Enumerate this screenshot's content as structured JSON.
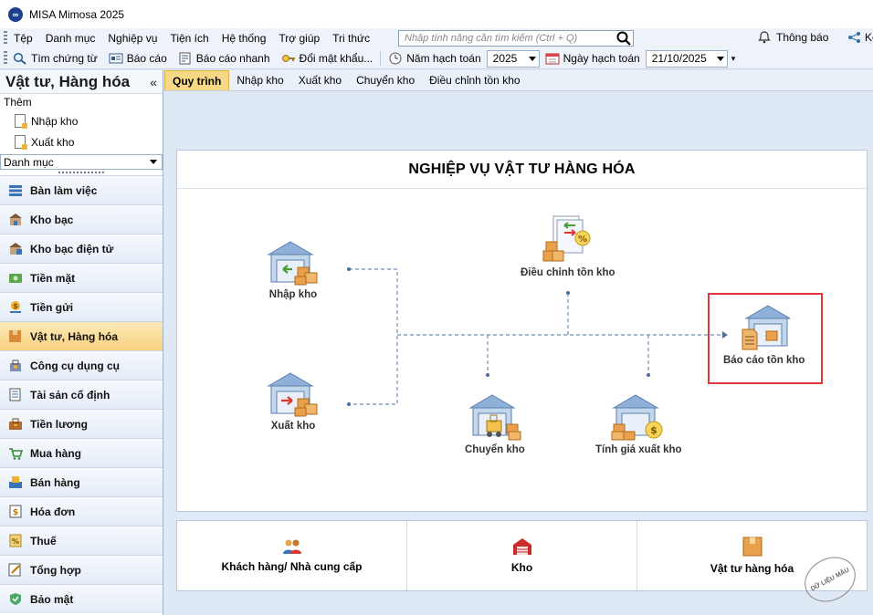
{
  "window": {
    "title": "MISA Mimosa 2025"
  },
  "menu": {
    "items": [
      "Tệp",
      "Danh mục",
      "Nghiệp vụ",
      "Tiện ích",
      "Hệ thống",
      "Trợ giúp",
      "Tri thức"
    ],
    "search_placeholder": "Nhập tính năng cần tìm kiếm (Ctrl + Q)",
    "notification_label": "Thông báo",
    "share_label": "Kế"
  },
  "toolbar": {
    "find_voucher": "Tìm chứng từ",
    "report": "Báo cáo",
    "quick_report": "Báo cáo nhanh",
    "change_password": "Đổi mật khẩu...",
    "fiscal_year_label": "Năm hạch toán",
    "fiscal_year_value": "2025",
    "accounting_date_label": "Ngày hạch toán",
    "accounting_date_value": "21/10/2025"
  },
  "sidebar": {
    "title": "Vật tư, Hàng hóa",
    "collapse": "«",
    "add_label": "Thêm",
    "add_items": [
      "Nhập kho",
      "Xuất kho"
    ],
    "category_select": "Danh mục",
    "nav": [
      {
        "label": "Bàn làm việc",
        "icon": "desk-icon"
      },
      {
        "label": "Kho bạc",
        "icon": "treasury-icon"
      },
      {
        "label": "Kho bạc điện tử",
        "icon": "e-treasury-icon"
      },
      {
        "label": "Tiền mặt",
        "icon": "cash-icon"
      },
      {
        "label": "Tiền gửi",
        "icon": "deposit-icon"
      },
      {
        "label": "Vật tư, Hàng hóa",
        "icon": "goods-icon",
        "active": true
      },
      {
        "label": "Công cụ dụng cụ",
        "icon": "tools-icon"
      },
      {
        "label": "Tài sản cố định",
        "icon": "fixed-asset-icon"
      },
      {
        "label": "Tiền lương",
        "icon": "salary-icon"
      },
      {
        "label": "Mua hàng",
        "icon": "purchase-icon"
      },
      {
        "label": "Bán hàng",
        "icon": "sales-icon"
      },
      {
        "label": "Hóa đơn",
        "icon": "invoice-icon"
      },
      {
        "label": "Thuế",
        "icon": "tax-icon"
      },
      {
        "label": "Tổng hợp",
        "icon": "summary-icon"
      },
      {
        "label": "Bảo mật",
        "icon": "security-icon"
      }
    ]
  },
  "tabs": [
    "Quy trình",
    "Nhập kho",
    "Xuất kho",
    "Chuyển kho",
    "Điều chỉnh tồn kho"
  ],
  "process": {
    "title": "NGHIỆP VỤ VẬT TƯ HÀNG HÓA",
    "nodes": {
      "import": "Nhập kho",
      "export": "Xuất kho",
      "adjust": "Điều chỉnh tồn kho",
      "transfer": "Chuyển kho",
      "costing": "Tính giá xuất kho",
      "stock_report": "Báo cáo tồn kho"
    }
  },
  "bottom": {
    "customers": "Khách hàng/ Nhà cung cấp",
    "warehouse": "Kho",
    "goods": "Vật tư hàng hóa"
  },
  "stamp": "DỮ LIỆU MẪU",
  "colors": {
    "highlight": "#e0373b",
    "active_tab": "#f7d985",
    "accent": "#1d3f8f"
  }
}
